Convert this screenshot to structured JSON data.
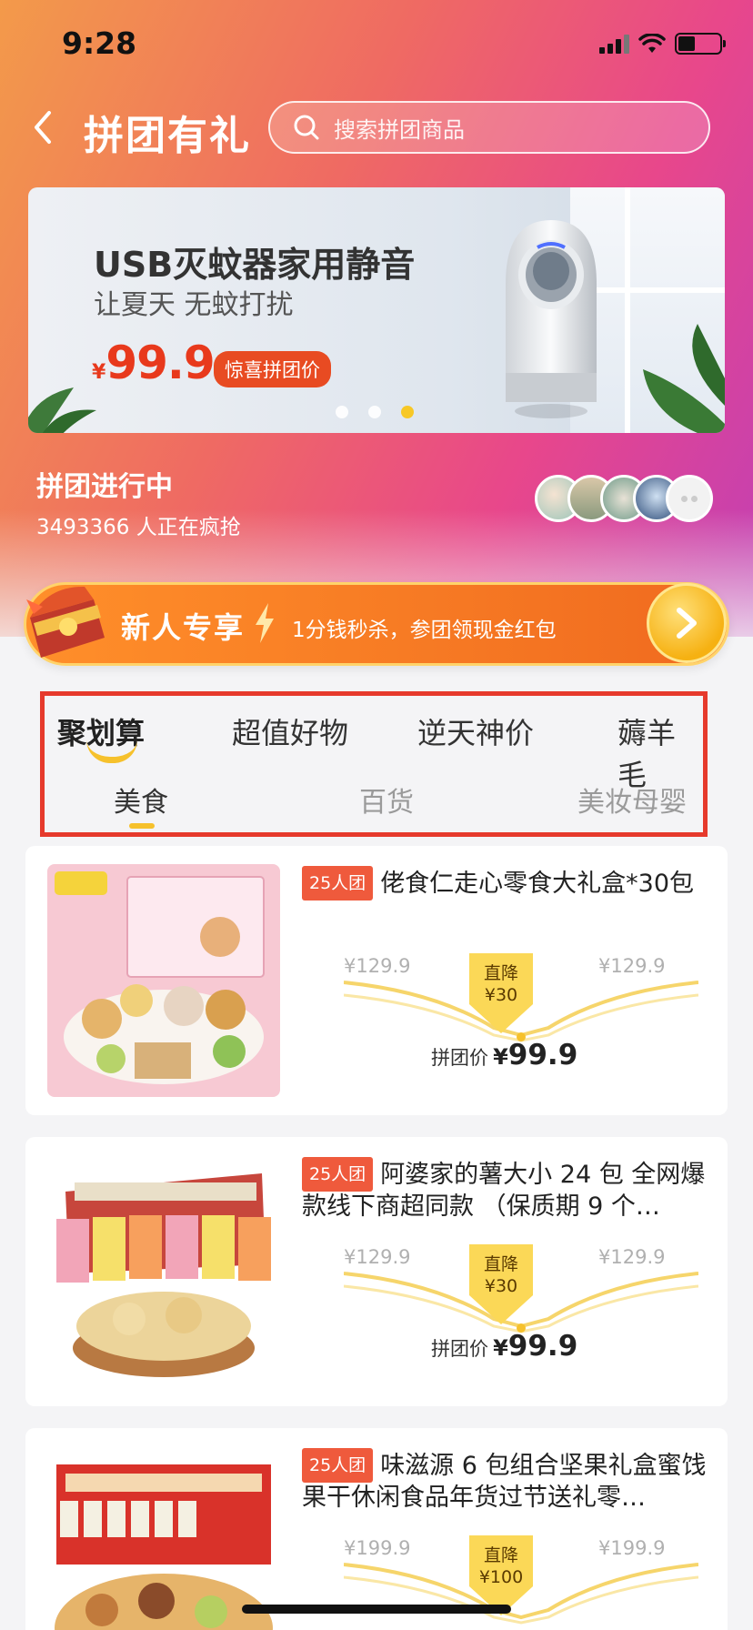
{
  "status_bar": {
    "time": "9:28"
  },
  "header": {
    "title": "拼团有礼",
    "search_placeholder": "搜索拼团商品"
  },
  "banner": {
    "title": "USB灭蚊器家用静音",
    "subtitle": "让夏天 无蚊打扰",
    "currency": "¥",
    "price": "99.9",
    "tag": "惊喜拼团价",
    "slides": 3,
    "active_slide": 3
  },
  "group_status": {
    "title": "拼团进行中",
    "count_text": "3493366 人正在疯抢"
  },
  "promo": {
    "title": "新人专享",
    "text": "1分钱秒杀，参团领现金红包"
  },
  "tabs_primary": [
    {
      "label": "聚划算",
      "active": true
    },
    {
      "label": "超值好物",
      "active": false
    },
    {
      "label": "逆天神价",
      "active": false
    },
    {
      "label": "薅羊毛",
      "active": false
    }
  ],
  "tabs_secondary": [
    {
      "label": "美食",
      "active": true
    },
    {
      "label": "百货",
      "active": false
    },
    {
      "label": "美妆母婴",
      "active": false
    }
  ],
  "products": [
    {
      "badge": "25人团",
      "title": "佬食仁走心零食大礼盒*30包",
      "price_left": "¥129.9",
      "price_right": "¥129.9",
      "drop_label": "直降",
      "drop_amount": "¥30",
      "final_label": "拼团价",
      "currency": "¥",
      "final_price": "99.9"
    },
    {
      "badge": "25人团",
      "title": "阿婆家的薯大小 24 包 全网爆款线下商超同款 （保质期 9 个…",
      "price_left": "¥129.9",
      "price_right": "¥129.9",
      "drop_label": "直降",
      "drop_amount": "¥30",
      "final_label": "拼团价",
      "currency": "¥",
      "final_price": "99.9"
    },
    {
      "badge": "25人团",
      "title": "味滋源 6 包组合坚果礼盒蜜饯果干休闲食品年货过节送礼零…",
      "price_left": "¥199.9",
      "price_right": "¥199.9",
      "drop_label": "直降",
      "drop_amount": "¥100",
      "final_label": "拼团价",
      "currency": "¥",
      "final_price": ""
    }
  ],
  "colors": {
    "accent_red": "#e8391c",
    "highlight_yellow": "#f6c12c",
    "annotation_box": "#e63a2c"
  }
}
